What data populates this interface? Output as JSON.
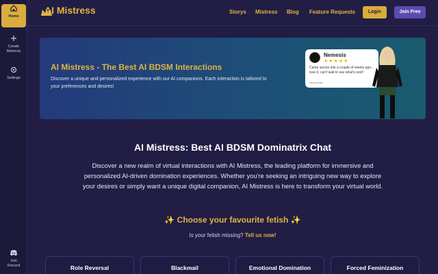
{
  "sidebar": {
    "home": "Home",
    "create": "Create\nMistress",
    "settings": "Settings",
    "discord": "Join\nDiscord"
  },
  "header": {
    "logo": "AI Mistress",
    "nav": [
      "Storys",
      "Mistress",
      "Blog",
      "Feature Requests"
    ],
    "login": "Login",
    "join": "Join Free"
  },
  "banner": {
    "title": "AI Mistress - The Best AI BDSM Interactions",
    "description": "Discover a unique and personalized experience with our AI companions. Each interaction is tailored to your preferences and desires!",
    "review": {
      "name": "Nemesis",
      "stars": "★★★★★",
      "text": "Came across site a couple of weeks ago... love it, can't wait to see what's next!",
      "user": "Discord User"
    }
  },
  "main": {
    "title": "AI Mistress: Best AI BDSM Dominatrix Chat",
    "intro": "Discover a new realm of virtual interactions with AI Mistress, the leading platform for immersive and personalized AI-driven domination experiences. Whether you're seeking an intriguing new way to explore your desires or simply want a unique digital companion, AI Mistress is here to transform your virtual world.",
    "fetish_heading": "✨ Choose your favourite fetish ✨",
    "fetish_question": "Is your fetish missing?",
    "fetish_link": "Tell us now!",
    "cards": [
      "Role Reversal",
      "Blackmail",
      "Emotional Domination",
      "Forced Feminization"
    ]
  },
  "colors": {
    "background": "#211d44",
    "accent": "#e0b443",
    "join_button": "#5b4bb0"
  }
}
